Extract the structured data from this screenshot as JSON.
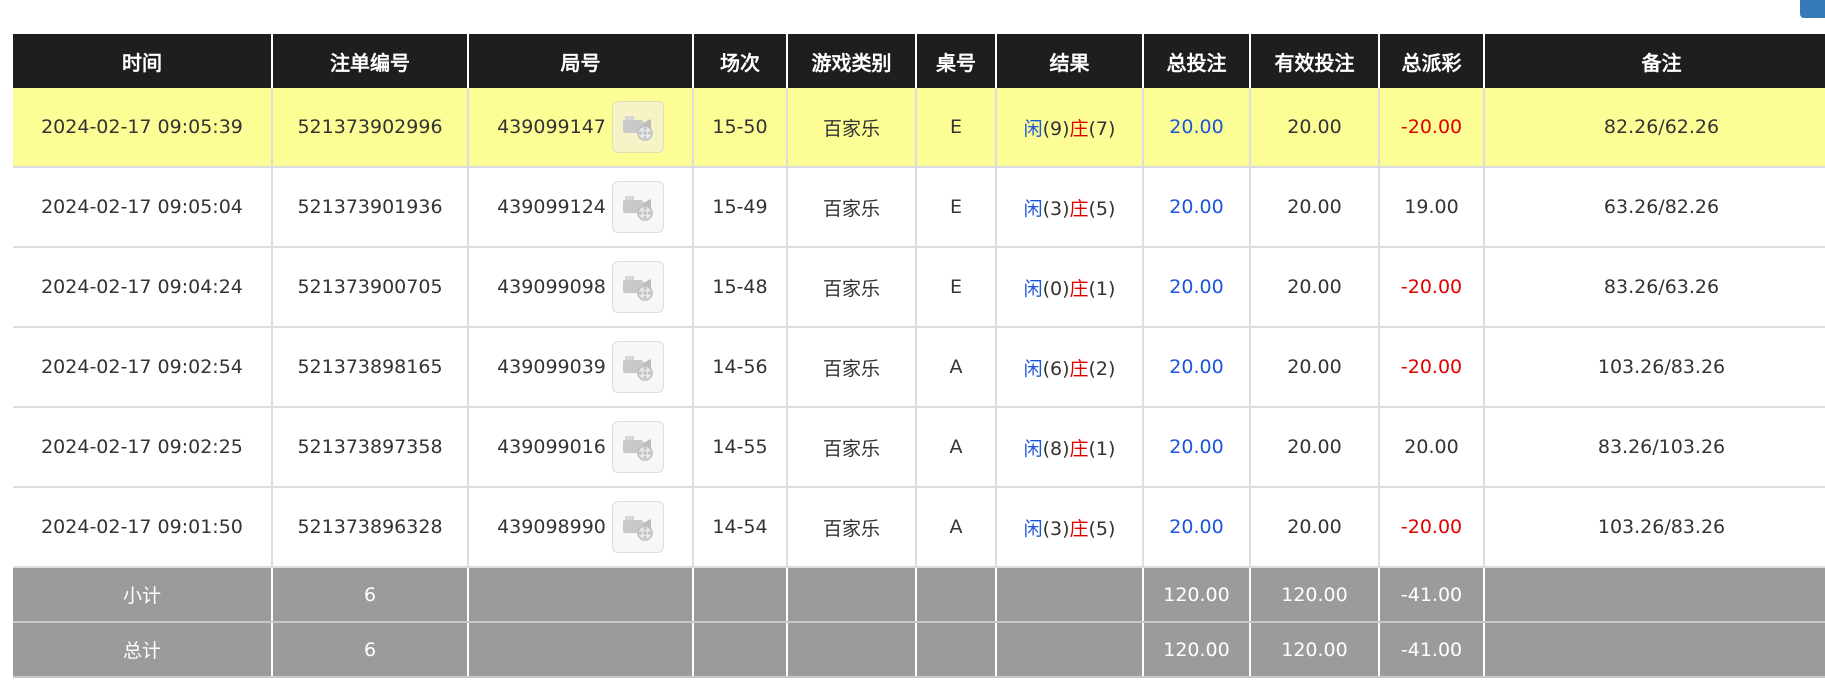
{
  "table": {
    "headers": [
      "时间",
      "注单编号",
      "局号",
      "场次",
      "游戏类别",
      "桌号",
      "结果",
      "总投注",
      "有效投注",
      "总派彩",
      "备注"
    ],
    "rows": [
      {
        "time": "2024-02-17 09:05:39",
        "bet_id": "521373902996",
        "round_id": "439099147",
        "session": "15-50",
        "game_type": "百家乐",
        "table_no": "E",
        "player_label": "闲",
        "player_score": "(9)",
        "banker_label": "庄",
        "banker_score": "(7)",
        "total_bet": "20.00",
        "valid_bet": "20.00",
        "payout": "-20.00",
        "remark": "82.26/62.26",
        "highlighted": true
      },
      {
        "time": "2024-02-17 09:05:04",
        "bet_id": "521373901936",
        "round_id": "439099124",
        "session": "15-49",
        "game_type": "百家乐",
        "table_no": "E",
        "player_label": "闲",
        "player_score": "(3)",
        "banker_label": "庄",
        "banker_score": "(5)",
        "total_bet": "20.00",
        "valid_bet": "20.00",
        "payout": "19.00",
        "remark": "63.26/82.26",
        "highlighted": false
      },
      {
        "time": "2024-02-17 09:04:24",
        "bet_id": "521373900705",
        "round_id": "439099098",
        "session": "15-48",
        "game_type": "百家乐",
        "table_no": "E",
        "player_label": "闲",
        "player_score": "(0)",
        "banker_label": "庄",
        "banker_score": "(1)",
        "total_bet": "20.00",
        "valid_bet": "20.00",
        "payout": "-20.00",
        "remark": "83.26/63.26",
        "highlighted": false
      },
      {
        "time": "2024-02-17 09:02:54",
        "bet_id": "521373898165",
        "round_id": "439099039",
        "session": "14-56",
        "game_type": "百家乐",
        "table_no": "A",
        "player_label": "闲",
        "player_score": "(6)",
        "banker_label": "庄",
        "banker_score": "(2)",
        "total_bet": "20.00",
        "valid_bet": "20.00",
        "payout": "-20.00",
        "remark": "103.26/83.26",
        "highlighted": false
      },
      {
        "time": "2024-02-17 09:02:25",
        "bet_id": "521373897358",
        "round_id": "439099016",
        "session": "14-55",
        "game_type": "百家乐",
        "table_no": "A",
        "player_label": "闲",
        "player_score": "(8)",
        "banker_label": "庄",
        "banker_score": "(1)",
        "total_bet": "20.00",
        "valid_bet": "20.00",
        "payout": "20.00",
        "remark": "83.26/103.26",
        "highlighted": false
      },
      {
        "time": "2024-02-17 09:01:50",
        "bet_id": "521373896328",
        "round_id": "439098990",
        "session": "14-54",
        "game_type": "百家乐",
        "table_no": "A",
        "player_label": "闲",
        "player_score": "(3)",
        "banker_label": "庄",
        "banker_score": "(5)",
        "total_bet": "20.00",
        "valid_bet": "20.00",
        "payout": "-20.00",
        "remark": "103.26/83.26",
        "highlighted": false
      }
    ],
    "summary": [
      {
        "label": "小计",
        "count": "6",
        "total_bet": "120.00",
        "valid_bet": "120.00",
        "payout": "-41.00"
      },
      {
        "label": "总计",
        "count": "6",
        "total_bet": "120.00",
        "valid_bet": "120.00",
        "payout": "-41.00"
      }
    ]
  },
  "icons": {
    "video_replay": "video-camera-reel-icon"
  },
  "colors": {
    "header_bg": "#1e1e1e",
    "highlight_row": "#fdfd96",
    "summary_bg": "#9b9b9b",
    "player_blue": "#1a56db",
    "banker_red": "#e00000",
    "corner_button": "#337ab7"
  }
}
